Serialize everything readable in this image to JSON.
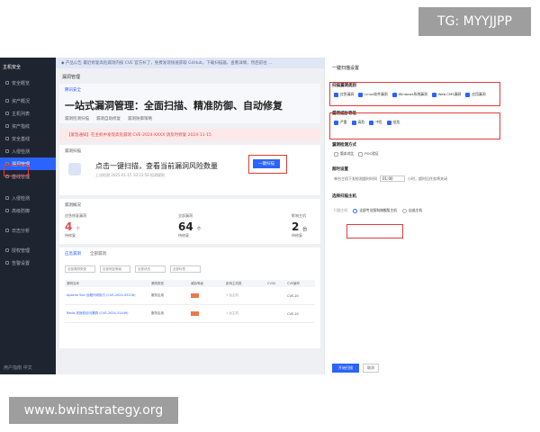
{
  "watermarks": {
    "top": "TG: MYYJJPP",
    "bottom": "www.bwinstrategy.org"
  },
  "sidebar": {
    "brand": "主机安全",
    "items": [
      {
        "label": "安全概览"
      },
      {
        "label": "资产概况"
      },
      {
        "label": "主机列表"
      },
      {
        "label": "资产指纹"
      },
      {
        "label": "安全基线"
      },
      {
        "label": "入侵检测"
      },
      {
        "label": "漏洞管理"
      },
      {
        "label": "基线管理"
      },
      {
        "label": "入侵检测"
      },
      {
        "label": "高级防御"
      },
      {
        "label": "日志分析"
      },
      {
        "label": "授权管理"
      },
      {
        "label": "告警设置"
      }
    ],
    "bottom": "用户指南 中文"
  },
  "main": {
    "notice": "◆ 产品公告  最近修复高危漏洞内核 CVE 官方补丁，免费发现快速获取 GitHub，下载扫描器，查看详情，然后前往 ...",
    "page_title": "漏洞管理",
    "hero": {
      "brand": "腾讯安全",
      "title": "一站式漏洞管理：全面扫描、精准防御、自动修复",
      "tabs": [
        "漏洞检测扫描",
        "漏洞自助修复",
        "漏洞防御策略"
      ]
    },
    "alert": "【紧急通知】在主机中发现高危漏洞 CVE-2024-XXXX  请及时修复 2024-11-15",
    "scan": {
      "label": "漏洞扫描",
      "headline": "点击一键扫描，查看当前漏洞风险数量",
      "meta": "上次检测 2025-01-15 10:23:56  检测规则",
      "button": "一键扫描"
    },
    "overview": {
      "label": "漏洞概况",
      "stats": [
        {
          "label": "应急修复漏洞",
          "value": "4",
          "unit": "个",
          "sub": "待修复"
        },
        {
          "label": "全部漏洞",
          "value": "64",
          "unit": "个",
          "sub": "待修复"
        },
        {
          "label": "影响主机",
          "value": "2",
          "unit": "台",
          "sub": "待修复"
        }
      ]
    },
    "list": {
      "tabs": [
        "应急漏洞",
        "全部漏洞"
      ],
      "filters": [
        "全部漏洞类型",
        "全部修复等级",
        "全部状态",
        "全部标签"
      ],
      "columns": [
        "漏洞名称",
        "漏洞类型",
        "威胁等级",
        "影响主机数",
        "CVSS",
        "CVE编号"
      ],
      "rows": [
        {
          "name": "Apache Solr 远程代码执行 (CVE-2024-45216)",
          "type": "服务应用",
          "host": "1 台主机",
          "cve": "CVE-20"
        },
        {
          "name": "Redis 未授权访问漏洞 (CVE-2024-31449)",
          "type": "服务应用",
          "host": "1 台主机",
          "cve": "CVE-20"
        }
      ]
    }
  },
  "panel": {
    "title": "一键扫描设置",
    "types_title": "扫描漏洞类别",
    "types": [
      {
        "label": "应急漏洞",
        "checked": true
      },
      {
        "label": "Linux软件漏洞",
        "checked": true
      },
      {
        "label": "Windows系统漏洞",
        "checked": true
      },
      {
        "label": "Web-CMS漏洞",
        "checked": true
      },
      {
        "label": "应用漏洞",
        "checked": true
      }
    ],
    "levels_title": "漏洞威胁等级",
    "levels": [
      {
        "label": "严重",
        "checked": true
      },
      {
        "label": "高危",
        "checked": true
      },
      {
        "label": "中危",
        "checked": true
      },
      {
        "label": "低危",
        "checked": true
      }
    ],
    "method_title": "漏洞检测方式",
    "methods": [
      {
        "label": "版本对比",
        "checked": false
      },
      {
        "label": "POC验证",
        "checked": false
      }
    ],
    "timeout_title": "超时设置",
    "timeout_prefix": "单台主机下发检测超时时间",
    "timeout_value": "01:00",
    "timeout_suffix": "小时，超时后任务将关闭",
    "host_title": "选择扫描主机",
    "host_prefix": "扫描主机",
    "host_options": [
      {
        "label": "全部专业版和旗舰版主机",
        "selected": true
      },
      {
        "label": "自选主机",
        "selected": false
      }
    ],
    "confirm": "开始扫描",
    "cancel": "取消"
  }
}
